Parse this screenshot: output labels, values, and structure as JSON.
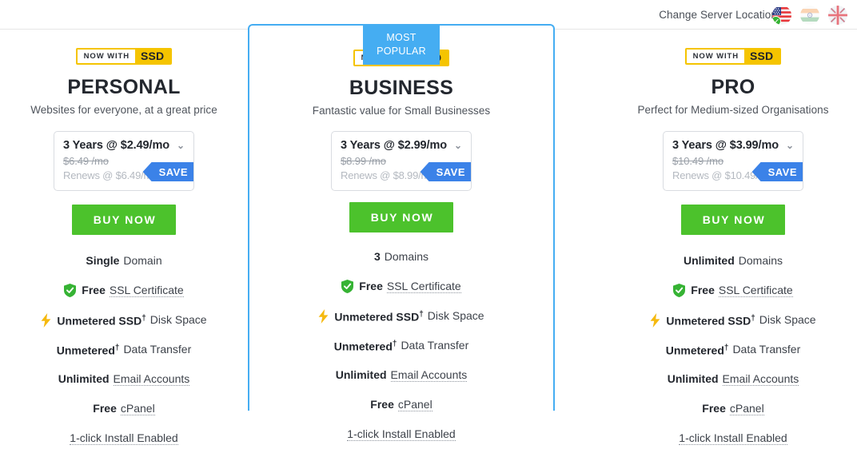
{
  "topbar": {
    "server_location_label": "Change Server Location",
    "flags": [
      {
        "name": "us-flag",
        "country": "United States",
        "selected": true
      },
      {
        "name": "india-flag",
        "country": "India",
        "selected": false
      },
      {
        "name": "uk-flag",
        "country": "United Kingdom",
        "selected": false
      }
    ]
  },
  "badge_now_with": "NOW WITH",
  "badge_ssd": "SSD",
  "most_popular": "MOST POPULAR",
  "buy_now_label": "BUY NOW",
  "save_label": "SAVE",
  "caret_glyph": "⌄",
  "plans": [
    {
      "id": "personal",
      "title": "PERSONAL",
      "subtitle": "Websites for everyone, at a great price",
      "price_term": "3 Years @ $2.49/mo",
      "price_old": "$6.49 /mo",
      "price_renew": "Renews @ $6.49/mo",
      "features": [
        {
          "strong": "Single",
          "rest": "Domain",
          "icon": null,
          "dotted": false,
          "dagger": false
        },
        {
          "strong": "Free",
          "rest": "SSL Certificate",
          "icon": "shield-check-icon",
          "dotted": true,
          "dagger": false
        },
        {
          "strong": "Unmetered SSD",
          "rest": "Disk Space",
          "icon": "lightning-bolt-icon",
          "dotted": false,
          "dagger": true
        },
        {
          "strong": "Unmetered",
          "rest": "Data Transfer",
          "icon": null,
          "dotted": false,
          "dagger": true
        },
        {
          "strong": "Unlimited",
          "rest": "Email Accounts",
          "icon": null,
          "dotted": true,
          "dagger": false
        },
        {
          "strong": "Free",
          "rest": "cPanel",
          "icon": null,
          "dotted": true,
          "dagger": false
        },
        {
          "strong": "",
          "rest": "1-click Install Enabled",
          "icon": null,
          "dotted": true,
          "dagger": false
        }
      ]
    },
    {
      "id": "business",
      "title": "BUSINESS",
      "subtitle": "Fantastic value for Small Businesses",
      "price_term": "3 Years @ $2.99/mo",
      "price_old": "$8.99 /mo",
      "price_renew": "Renews @ $8.99/mo",
      "features": [
        {
          "strong": "3",
          "rest": "Domains",
          "icon": null,
          "dotted": false,
          "dagger": false
        },
        {
          "strong": "Free",
          "rest": "SSL Certificate",
          "icon": "shield-check-icon",
          "dotted": true,
          "dagger": false
        },
        {
          "strong": "Unmetered SSD",
          "rest": "Disk Space",
          "icon": "lightning-bolt-icon",
          "dotted": false,
          "dagger": true
        },
        {
          "strong": "Unmetered",
          "rest": "Data Transfer",
          "icon": null,
          "dotted": false,
          "dagger": true
        },
        {
          "strong": "Unlimited",
          "rest": "Email Accounts",
          "icon": null,
          "dotted": true,
          "dagger": false
        },
        {
          "strong": "Free",
          "rest": "cPanel",
          "icon": null,
          "dotted": true,
          "dagger": false
        },
        {
          "strong": "",
          "rest": "1-click Install Enabled",
          "icon": null,
          "dotted": true,
          "dagger": false
        }
      ]
    },
    {
      "id": "pro",
      "title": "PRO",
      "subtitle": "Perfect for Medium-sized Organisations",
      "price_term": "3 Years @ $3.99/mo",
      "price_old": "$10.49 /mo",
      "price_renew": "Renews @ $10.49/mo",
      "features": [
        {
          "strong": "Unlimited",
          "rest": "Domains",
          "icon": null,
          "dotted": false,
          "dagger": false
        },
        {
          "strong": "Free",
          "rest": "SSL Certificate",
          "icon": "shield-check-icon",
          "dotted": true,
          "dagger": false
        },
        {
          "strong": "Unmetered SSD",
          "rest": "Disk Space",
          "icon": "lightning-bolt-icon",
          "dotted": false,
          "dagger": true
        },
        {
          "strong": "Unmetered",
          "rest": "Data Transfer",
          "icon": null,
          "dotted": false,
          "dagger": true
        },
        {
          "strong": "Unlimited",
          "rest": "Email Accounts",
          "icon": null,
          "dotted": true,
          "dagger": false
        },
        {
          "strong": "Free",
          "rest": "cPanel",
          "icon": null,
          "dotted": true,
          "dagger": false
        },
        {
          "strong": "",
          "rest": "1-click Install Enabled",
          "icon": null,
          "dotted": true,
          "dagger": false
        }
      ]
    }
  ],
  "colors": {
    "accent_blue": "#45adf2",
    "badge_yellow": "#f5c400",
    "buy_green": "#4cc22c",
    "save_blue": "#3b82e8",
    "shield_green": "#36b334"
  }
}
